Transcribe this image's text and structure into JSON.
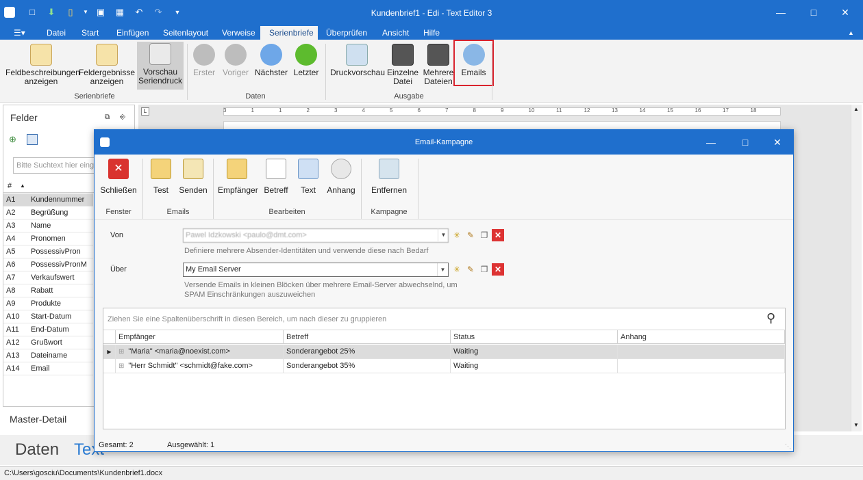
{
  "app": {
    "title": "Kundenbrief1 - Edi - Text Editor 3"
  },
  "menu_tabs": [
    "Datei",
    "Start",
    "Einfügen",
    "Seitenlayout",
    "Verweise",
    "Serienbriefe",
    "Überprüfen",
    "Ansicht",
    "Hilfe"
  ],
  "active_tab": "Serienbriefe",
  "ribbon": {
    "serienbriefe": {
      "label": "Serienbriefe",
      "buttons": [
        "Feldbeschreibungen anzeigen",
        "Feldergebnisse anzeigen",
        "Vorschau Seriendruck"
      ]
    },
    "daten": {
      "label": "Daten",
      "buttons": [
        "Erster",
        "Voriger",
        "Nächster",
        "Letzter"
      ]
    },
    "ausgabe": {
      "label": "Ausgabe",
      "buttons": [
        "Druckvorschau",
        "Einzelne Datei",
        "Mehrere Dateien",
        "Emails"
      ]
    }
  },
  "left_panel": {
    "title": "Felder",
    "search_placeholder": "Bitte Suchtext hier einge",
    "col_num": "#",
    "fields": [
      {
        "id": "A1",
        "name": "Kundennummer"
      },
      {
        "id": "A2",
        "name": "Begrüßung"
      },
      {
        "id": "A3",
        "name": "Name"
      },
      {
        "id": "A4",
        "name": "Pronomen"
      },
      {
        "id": "A5",
        "name": "PossessivPron"
      },
      {
        "id": "A6",
        "name": "PossessivPronM"
      },
      {
        "id": "A7",
        "name": "Verkaufswert"
      },
      {
        "id": "A8",
        "name": "Rabatt"
      },
      {
        "id": "A9",
        "name": "Produkte"
      },
      {
        "id": "A10",
        "name": "Start-Datum"
      },
      {
        "id": "A11",
        "name": "End-Datum"
      },
      {
        "id": "A12",
        "name": "Grußwort"
      },
      {
        "id": "A13",
        "name": "Dateiname"
      },
      {
        "id": "A14",
        "name": "Email"
      }
    ],
    "master_detail": "Master-Detail"
  },
  "bottom_tabs": {
    "daten": "Daten",
    "text": "Text"
  },
  "statusbar": {
    "path": "C:\\Users\\gosciu\\Documents\\Kundenbrief1.docx"
  },
  "ruler": {
    "numbers": [
      "3",
      "1",
      "1",
      "2",
      "3",
      "4",
      "5",
      "6",
      "7",
      "8",
      "9",
      "10",
      "11",
      "12",
      "13",
      "14",
      "15",
      "16",
      "17",
      "18"
    ]
  },
  "dialog": {
    "title": "Email-Kampagne",
    "groups": {
      "fenster": {
        "label": "Fenster",
        "buttons": [
          "Schließen"
        ]
      },
      "emails": {
        "label": "Emails",
        "buttons": [
          "Test",
          "Senden"
        ]
      },
      "bearbeiten": {
        "label": "Bearbeiten",
        "buttons": [
          "Empfänger",
          "Betreff",
          "Text",
          "Anhang"
        ]
      },
      "kampagne": {
        "label": "Kampagne",
        "buttons": [
          "Entfernen"
        ]
      }
    },
    "von": {
      "label": "Von",
      "value": "Pawel Idzkowski <paulo@dmt.com>",
      "hint": "Definiere mehrere Absender-Identitäten und verwende diese nach Bedarf"
    },
    "ueber": {
      "label": "Über",
      "value": "My Email Server",
      "hint": "Versende Emails in kleinen Blöcken über mehrere Email-Server abwechselnd, um SPAM Einschränkungen auszuweichen"
    },
    "grid": {
      "group_hint": "Ziehen Sie eine Spaltenüberschrift in diesen Bereich, um nach dieser zu gruppieren",
      "columns": [
        "Empfänger",
        "Betreff",
        "Status",
        "Anhang"
      ],
      "rows": [
        {
          "empfaenger": "\"Maria\" <maria@noexist.com>",
          "betreff": "Sonderangebot 25%",
          "status": "Waiting",
          "anhang": ""
        },
        {
          "empfaenger": "\"Herr Schmidt\" <schmidt@fake.com>",
          "betreff": "Sonderangebot 35%",
          "status": "Waiting",
          "anhang": ""
        }
      ]
    },
    "footer": {
      "gesamt": "Gesamt: 2",
      "ausgewaehlt": "Ausgewählt: 1"
    }
  }
}
